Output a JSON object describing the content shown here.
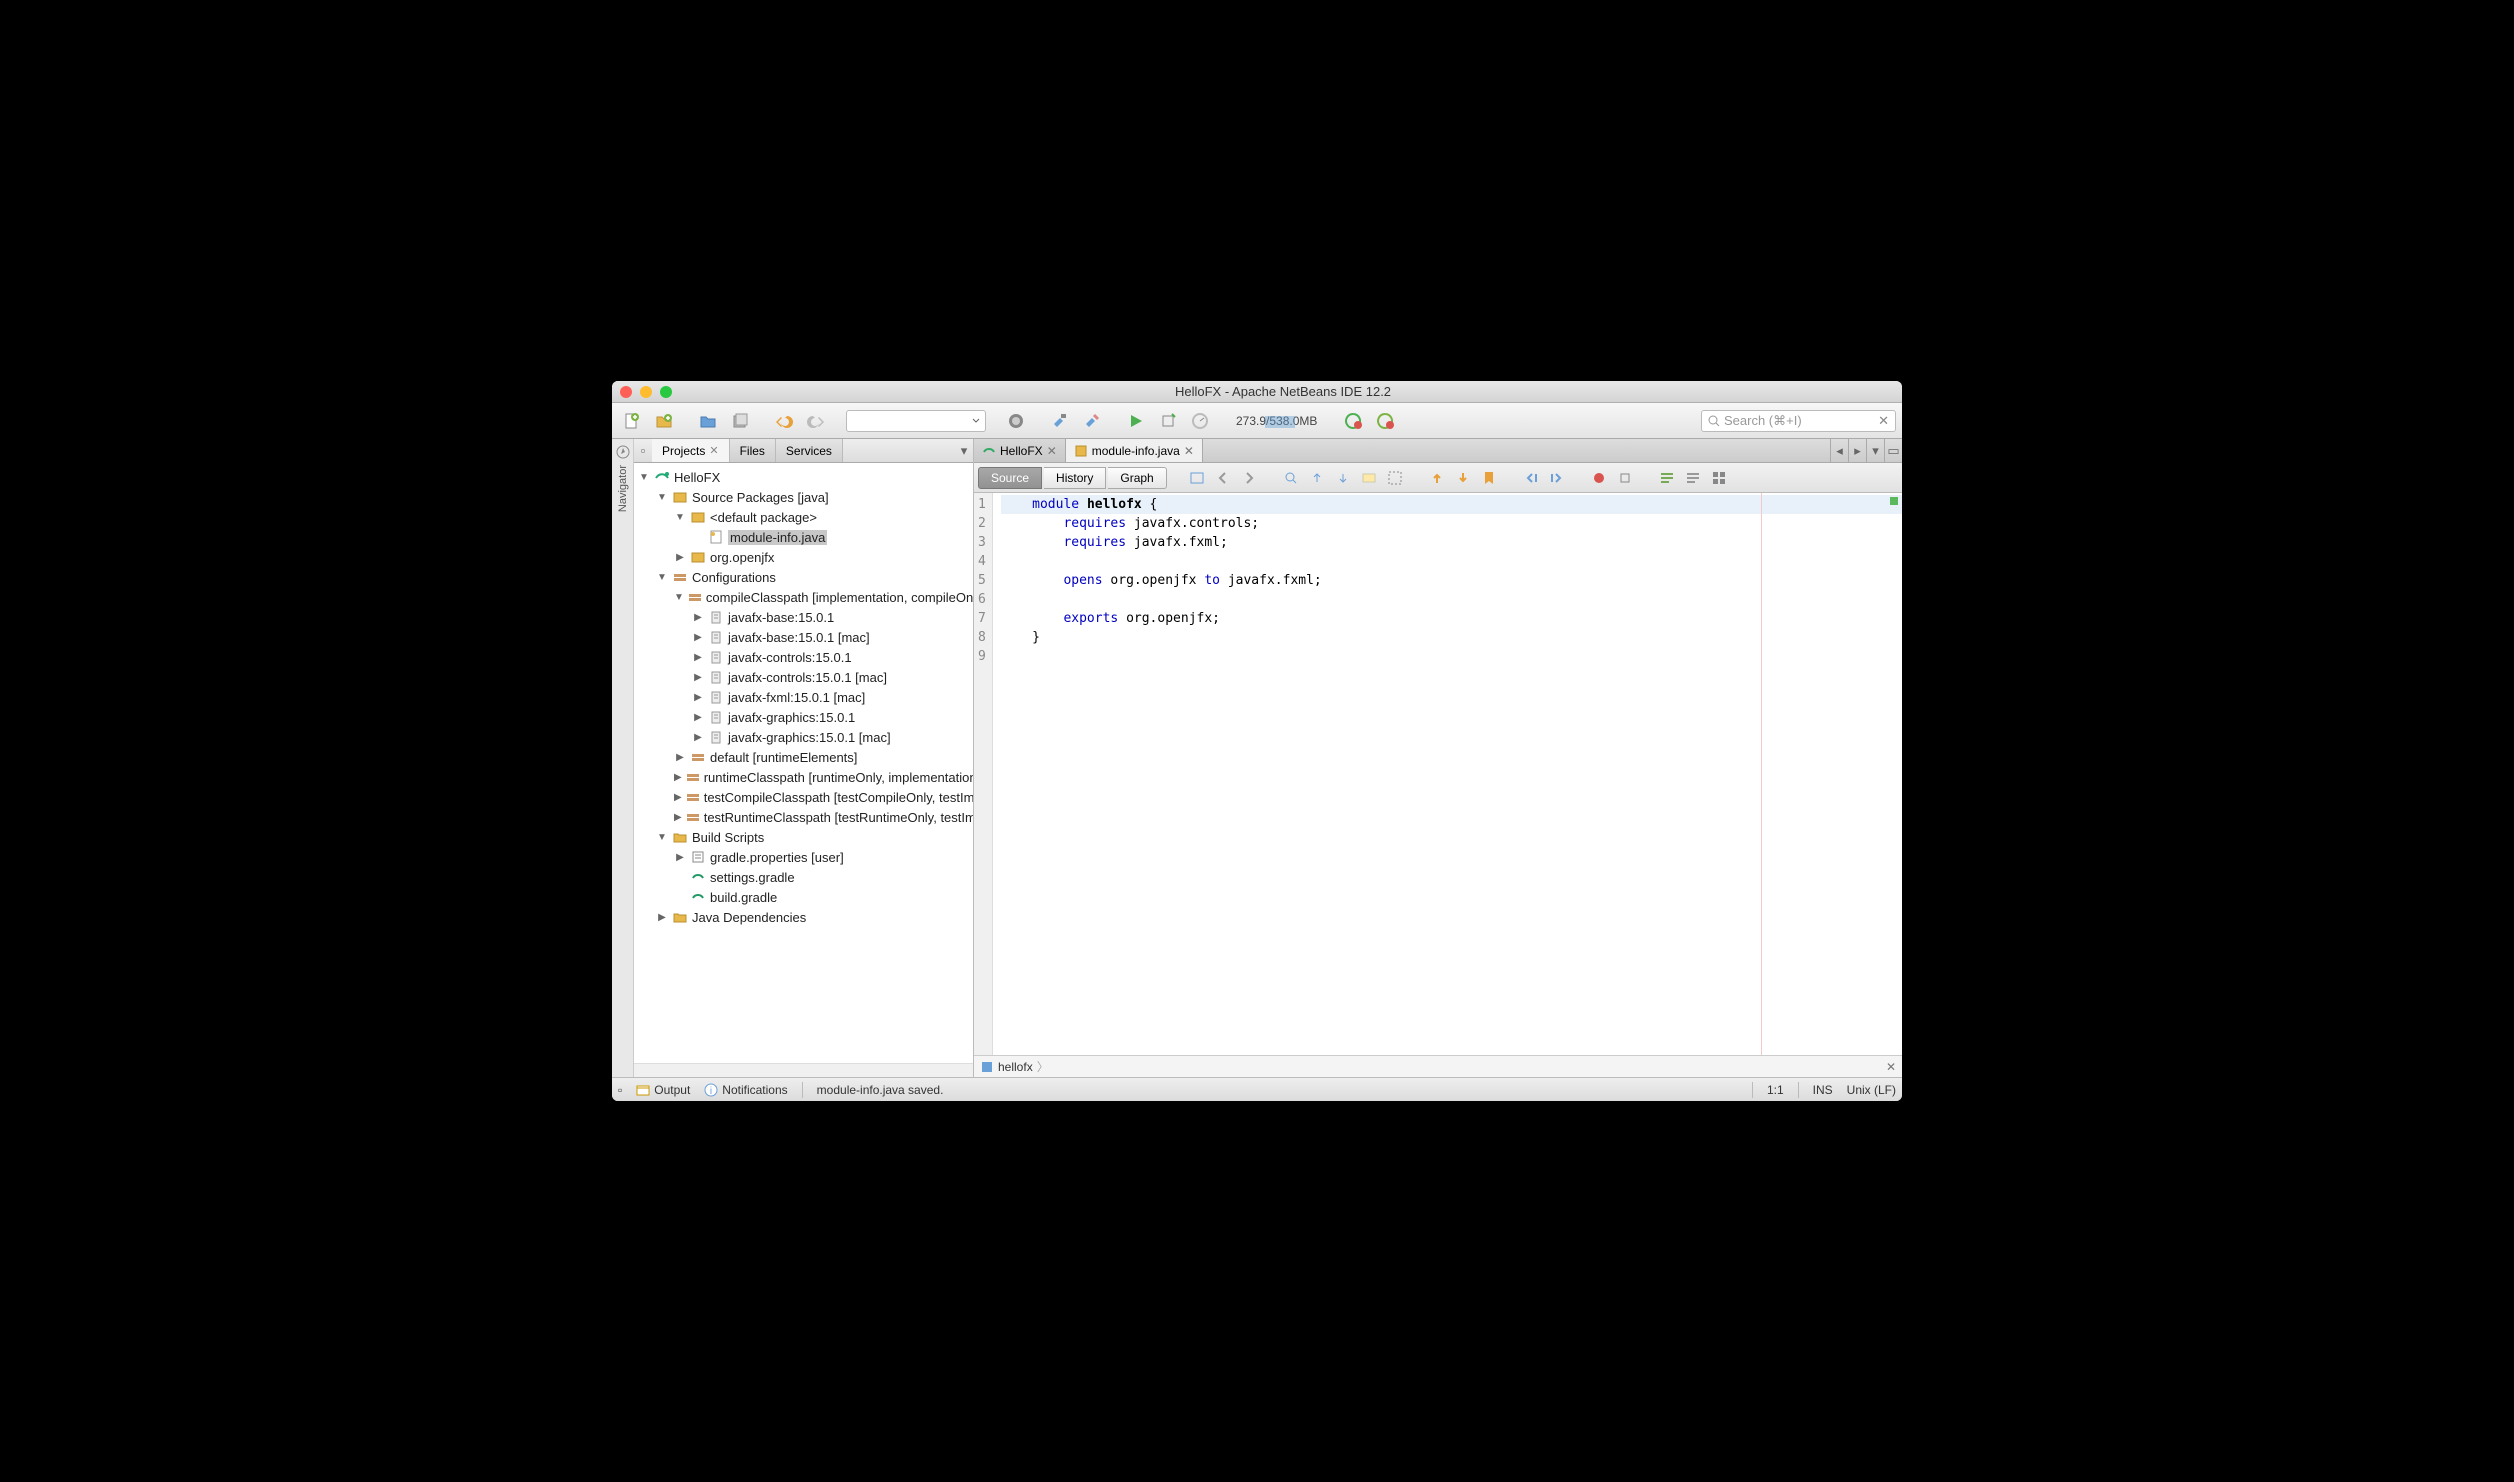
{
  "window": {
    "title": "HelloFX - Apache NetBeans IDE 12.2"
  },
  "toolbar": {
    "memory": "273.9/538.0MB",
    "search_placeholder": "Search (⌘+I)"
  },
  "leftTabs": [
    {
      "label": "Projects",
      "active": true,
      "closable": true
    },
    {
      "label": "Files",
      "active": false,
      "closable": false
    },
    {
      "label": "Services",
      "active": false,
      "closable": false
    }
  ],
  "navigator_label": "Navigator",
  "tree": {
    "root": "HelloFX",
    "source_packages": "Source Packages [java]",
    "default_package": "<default package>",
    "module_info": "module-info.java",
    "org_openjfx": "org.openjfx",
    "configurations": "Configurations",
    "compileClasspath": "compileClasspath [implementation, compileOnly]",
    "deps": [
      "javafx-base:15.0.1",
      "javafx-base:15.0.1 [mac]",
      "javafx-controls:15.0.1",
      "javafx-controls:15.0.1 [mac]",
      "javafx-fxml:15.0.1 [mac]",
      "javafx-graphics:15.0.1",
      "javafx-graphics:15.0.1 [mac]"
    ],
    "configs": [
      "default [runtimeElements]",
      "runtimeClasspath [runtimeOnly, implementation]",
      "testCompileClasspath [testCompileOnly, testImplementation]",
      "testRuntimeClasspath [testRuntimeOnly, testImplementation]"
    ],
    "build_scripts": "Build Scripts",
    "scripts": [
      "gradle.properties [user]",
      "settings.gradle",
      "build.gradle"
    ],
    "java_deps": "Java Dependencies"
  },
  "editorTabs": [
    {
      "label": "HelloFX",
      "active": false
    },
    {
      "label": "module-info.java",
      "active": true
    }
  ],
  "editorToolbar": {
    "source": "Source",
    "history": "History",
    "graph": "Graph"
  },
  "code": {
    "lines": [
      {
        "n": 1,
        "indent": "    ",
        "tokens": [
          [
            "kw",
            "module"
          ],
          [
            " "
          ],
          [
            "id",
            "hellofx"
          ],
          [
            " {"
          ]
        ],
        "hl": true
      },
      {
        "n": 2,
        "indent": "        ",
        "tokens": [
          [
            "kw",
            "requires"
          ],
          [
            " javafx.controls;"
          ]
        ]
      },
      {
        "n": 3,
        "indent": "        ",
        "tokens": [
          [
            "kw",
            "requires"
          ],
          [
            " javafx.fxml;"
          ]
        ]
      },
      {
        "n": 4,
        "indent": "",
        "tokens": []
      },
      {
        "n": 5,
        "indent": "        ",
        "tokens": [
          [
            "kw",
            "opens"
          ],
          [
            " org.openjfx "
          ],
          [
            "kw",
            "to"
          ],
          [
            " javafx.fxml;"
          ]
        ]
      },
      {
        "n": 6,
        "indent": "",
        "tokens": []
      },
      {
        "n": 7,
        "indent": "        ",
        "tokens": [
          [
            "kw",
            "exports"
          ],
          [
            " org.openjfx;"
          ]
        ]
      },
      {
        "n": 8,
        "indent": "    ",
        "tokens": [
          [
            "}"
          ]
        ]
      },
      {
        "n": 9,
        "indent": "",
        "tokens": []
      }
    ]
  },
  "breadcrumb": {
    "item": "hellofx"
  },
  "status": {
    "output": "Output",
    "notifications": "Notifications",
    "message": "module-info.java saved.",
    "cursor": "1:1",
    "ins": "INS",
    "eol": "Unix (LF)"
  }
}
